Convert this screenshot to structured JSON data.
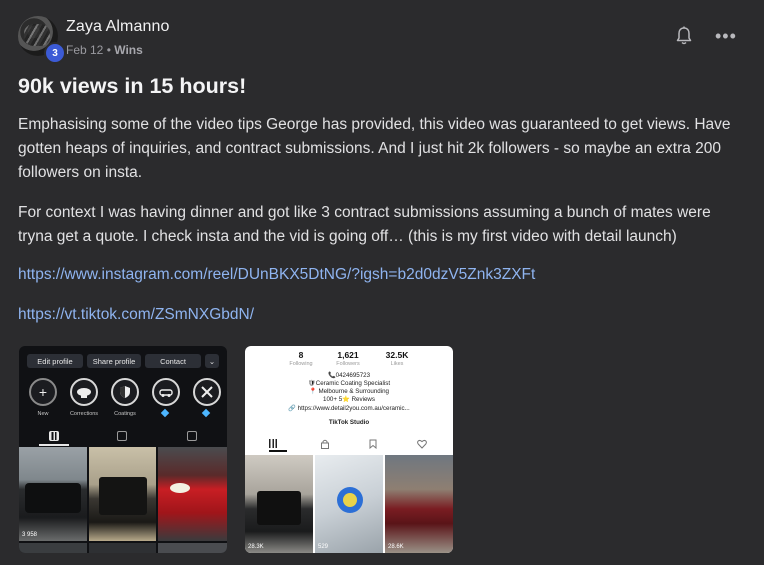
{
  "post": {
    "author": "Zaya Almanno",
    "level": "3",
    "date": "Feb 12",
    "separator": "•",
    "category": "Wins",
    "title": "90k views in 15 hours!",
    "paragraphs": [
      "Emphasising some of the video tips George has provided, this video was guaranteed to get views. Have gotten heaps of inquiries, and contract submissions. And I just hit 2k followers - so maybe an extra 200 followers on insta.",
      "For context I was having dinner and got like 3 contract submissions assuming a bunch of mates were tryna get a quote. I check insta and the vid is going off… (this is my first video with detail launch)"
    ],
    "links": [
      "https://www.instagram.com/reel/DUnBKX5DtNG/?igsh=b2d0dzV5Znk3ZXFt",
      "https://vt.tiktok.com/ZSmNXGbdN/"
    ],
    "more_icon": "•••"
  },
  "instagram_shot": {
    "buttons": [
      "Edit profile",
      "Share profile",
      "Contact"
    ],
    "chevron": "⌄",
    "highlights": [
      "New",
      "Corrections",
      "Coatings",
      "",
      ""
    ],
    "new_glyph": "+",
    "views": [
      "3 958"
    ]
  },
  "tiktok_shot": {
    "stats": [
      {
        "value": "8",
        "label": "Following"
      },
      {
        "value": "1,621",
        "label": "Followers"
      },
      {
        "value": "32.5K",
        "label": "Likes"
      }
    ],
    "bio": [
      "📞0424695723",
      "🛡Ceramic Coating Specialist",
      "📍 Melbourne & Surrounding",
      "100+  5⭐ Reviews",
      "🔗 https://www.detail2you.com.au/ceramic..."
    ],
    "studio": "TikTok Studio",
    "views": [
      "28.3K",
      "529",
      "28.6K"
    ]
  },
  "colors": {
    "background": "#2b2b2d",
    "link": "#8fb4f0",
    "badge": "#3c5bd6"
  },
  "icons": [
    "bell-icon",
    "more-icon",
    "grid-icon",
    "reels-icon",
    "tagged-icon",
    "lock-icon",
    "bookmark-icon",
    "heart-icon"
  ]
}
